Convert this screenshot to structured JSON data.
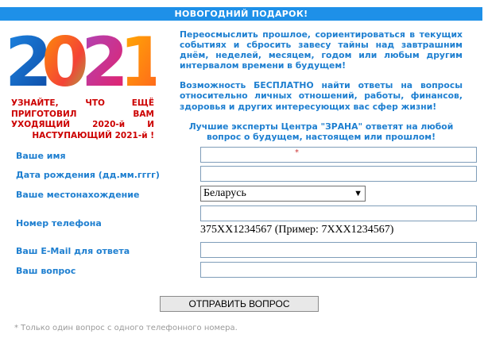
{
  "banner": "НОВОГОДНИЙ ПОДАРОК!",
  "logo": {
    "year": "2021"
  },
  "promo": "УЗНАЙТЕ, ЧТО ЕЩЁ ПРИГОТОВИЛ ВАМ УХОДЯЩИЙ 2020-й И НАСТУПАЮЩИЙ 2021-й !",
  "description": [
    "Переосмыслить прошлое, сориентироваться в текущих событиях и сбросить завесу тайны над завтрашним днём, неделей, месяцем, годом или любым другим интервалом времени в будущем!",
    "Возможность БЕСПЛАТНО найти ответы на вопросы относительно личных отношений, работы, финансов, здоровья и других интересующих вас сфер жизни!",
    "Лучшие эксперты Центра \"ЗРАНА\" ответят на любой вопрос о будущем, настоящем или прошлом!"
  ],
  "form": {
    "name_label": "Ваше имя",
    "name_value": "",
    "name_required_mark": "*",
    "birth_label": "Дата рождения (дд.мм.гггг)",
    "birth_value": "",
    "location_label": "Ваше местонахождение",
    "location_selected": "Беларусь",
    "phone_label": "Номер телефона",
    "phone_value": "",
    "phone_hint": "375XX1234567 (Пример: 7XXX1234567)",
    "email_label": "Ваш E-Mail для ответа",
    "email_value": "",
    "question_label": "Ваш вопрос",
    "question_value": ""
  },
  "submit_label": "ОТПРАВИТЬ ВОПРОС",
  "note": "* Только один вопрос с одного телефонного номера.",
  "colors": {
    "banner_bg": "#1e90e8",
    "label": "#1e7fd0",
    "promo": "#cc0000",
    "note": "#9a9a9a"
  }
}
